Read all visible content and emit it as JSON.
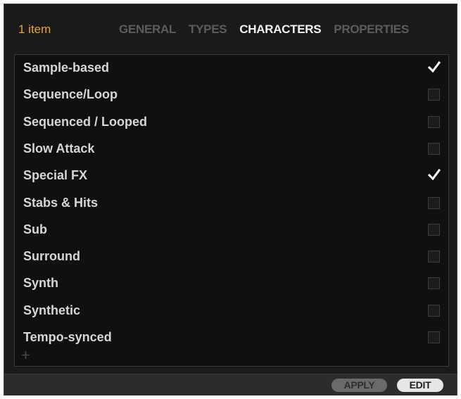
{
  "header": {
    "item_count": "1 item",
    "tabs": [
      {
        "label": "GENERAL",
        "active": false
      },
      {
        "label": "TYPES",
        "active": false
      },
      {
        "label": "CHARACTERS",
        "active": true
      },
      {
        "label": "PROPERTIES",
        "active": false
      }
    ]
  },
  "list": {
    "items": [
      {
        "label": "Sample-based",
        "checked": true
      },
      {
        "label": "Sequence/Loop",
        "checked": false
      },
      {
        "label": "Sequenced / Looped",
        "checked": false
      },
      {
        "label": "Slow Attack",
        "checked": false
      },
      {
        "label": "Special FX",
        "checked": true
      },
      {
        "label": "Stabs & Hits",
        "checked": false
      },
      {
        "label": "Sub",
        "checked": false
      },
      {
        "label": "Surround",
        "checked": false
      },
      {
        "label": "Synth",
        "checked": false
      },
      {
        "label": "Synthetic",
        "checked": false
      },
      {
        "label": "Tempo-synced",
        "checked": false
      }
    ],
    "add_icon": "plus-icon"
  },
  "footer": {
    "apply_label": "APPLY",
    "edit_label": "EDIT"
  },
  "colors": {
    "accent": "#e8a531",
    "background": "#1a1a1a",
    "active_tab": "#f2f2f2",
    "inactive_tab": "#5c5c5c"
  }
}
